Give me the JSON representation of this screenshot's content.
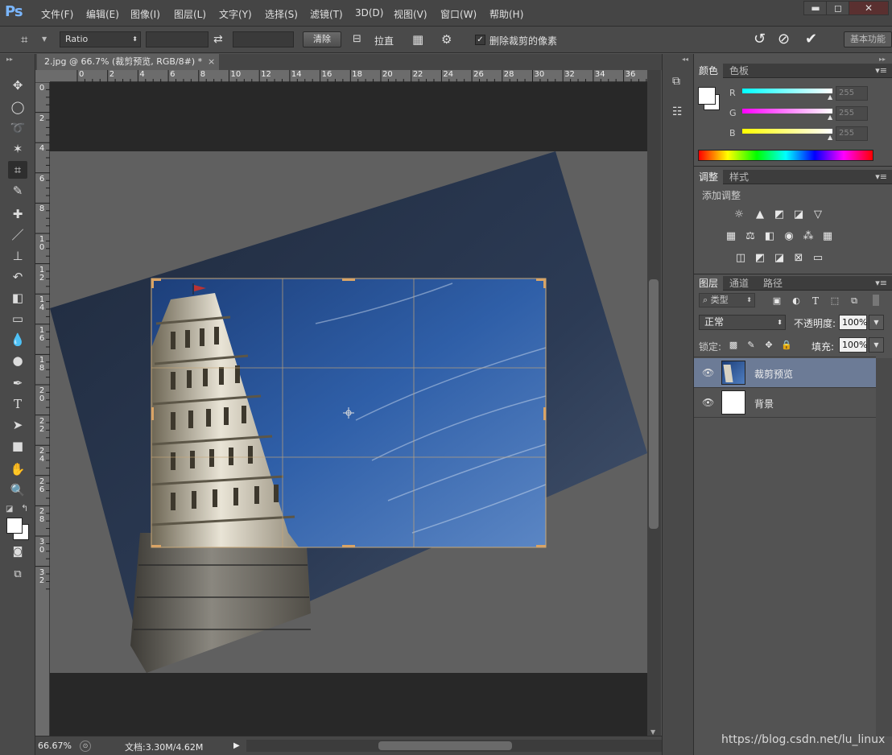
{
  "app": {
    "logo": "Ps"
  },
  "menu": [
    "文件(F)",
    "编辑(E)",
    "图像(I)",
    "图层(L)",
    "文字(Y)",
    "选择(S)",
    "滤镜(T)",
    "3D(D)",
    "视图(V)",
    "窗口(W)",
    "帮助(H)"
  ],
  "window_controls": {
    "minimize": "▬",
    "maximize": "◻",
    "close": "✕"
  },
  "options": {
    "ratio_select": "Ratio",
    "clear_label": "清除",
    "straighten_label": "拉直",
    "delete_pixels_checked": true,
    "delete_pixels_label": "删除裁剪的像素",
    "workspace_label": "基本功能"
  },
  "document": {
    "tab_title": "2.jpg @ 66.7% (裁剪预览, RGB/8#) *",
    "tab_close": "×",
    "ruler_top": [
      "0",
      "2",
      "4",
      "6",
      "8",
      "10",
      "12",
      "14",
      "16",
      "18",
      "20",
      "22",
      "24",
      "26",
      "28",
      "30",
      "32",
      "34",
      "36"
    ],
    "ruler_left": [
      "0",
      "2",
      "4",
      "6",
      "8",
      "1 0",
      "1 2",
      "1 4",
      "1 6",
      "1 8",
      "2 0",
      "2 2",
      "2 4",
      "2 6",
      "2 8",
      "3 0",
      "3 2"
    ]
  },
  "status": {
    "zoom": "66.67%",
    "doc_size": "文档:3.30M/4.62M"
  },
  "color_panel": {
    "tabs": [
      "颜色",
      "色板"
    ],
    "channels": [
      {
        "label": "R",
        "value": "255"
      },
      {
        "label": "G",
        "value": "255"
      },
      {
        "label": "B",
        "value": "255"
      }
    ],
    "colors": {
      "r": "#00ffff",
      "g": "#ff00ff",
      "b": "#ffff00"
    }
  },
  "adjust_panel": {
    "tabs": [
      "调整",
      "样式"
    ],
    "title": "添加调整"
  },
  "layers_panel": {
    "tabs": [
      "图层",
      "通道",
      "路径"
    ],
    "filter_label": "类型",
    "blend_mode": "正常",
    "opacity_label": "不透明度:",
    "opacity_value": "100%",
    "lock_label": "锁定:",
    "fill_label": "填充:",
    "fill_value": "100%",
    "layers": [
      {
        "name": "裁剪预览",
        "selected": true
      },
      {
        "name": "背景",
        "selected": false
      }
    ]
  },
  "watermark": "https://blog.csdn.net/lu_linux"
}
